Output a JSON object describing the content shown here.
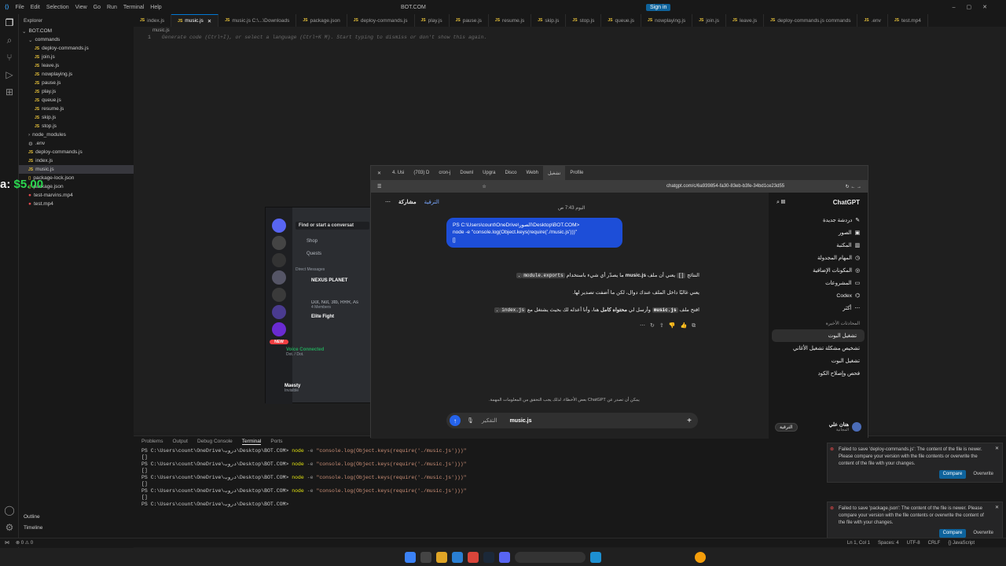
{
  "vscode": {
    "title": "BOT.COM",
    "menu": [
      "File",
      "Edit",
      "Selection",
      "View",
      "Go",
      "Run",
      "Terminal",
      "Help"
    ],
    "sign_in": "Sign in",
    "explorer_title": "Explorer",
    "tree": [
      {
        "label": "BOT.COM",
        "indent": 0,
        "type": "folder-open"
      },
      {
        "label": "commands",
        "indent": 1,
        "type": "folder-open"
      },
      {
        "label": "deploy-commands.js",
        "indent": 2,
        "type": "js"
      },
      {
        "label": "join.js",
        "indent": 2,
        "type": "js"
      },
      {
        "label": "leave.js",
        "indent": 2,
        "type": "js"
      },
      {
        "label": "nowplaying.js",
        "indent": 2,
        "type": "js"
      },
      {
        "label": "pause.js",
        "indent": 2,
        "type": "js"
      },
      {
        "label": "play.js",
        "indent": 2,
        "type": "js"
      },
      {
        "label": "queue.js",
        "indent": 2,
        "type": "js"
      },
      {
        "label": "resume.js",
        "indent": 2,
        "type": "js"
      },
      {
        "label": "skip.js",
        "indent": 2,
        "type": "js"
      },
      {
        "label": "stop.js",
        "indent": 2,
        "type": "js"
      },
      {
        "label": "node_modules",
        "indent": 1,
        "type": "folder"
      },
      {
        "label": ".env",
        "indent": 1,
        "type": "env"
      },
      {
        "label": "deploy-commands.js",
        "indent": 1,
        "type": "js"
      },
      {
        "label": "index.js",
        "indent": 1,
        "type": "js"
      },
      {
        "label": "music.js",
        "indent": 1,
        "type": "js",
        "selected": true
      },
      {
        "label": "package-lock.json",
        "indent": 1,
        "type": "json"
      },
      {
        "label": "package.json",
        "indent": 1,
        "type": "json"
      },
      {
        "label": "test-marvins.mp4",
        "indent": 1,
        "type": "media"
      },
      {
        "label": "test.mp4",
        "indent": 1,
        "type": "media"
      }
    ],
    "outline_label": "Outline",
    "timeline_label": "Timeline",
    "tabs": [
      "index.js",
      "music.js",
      "music.js C:\\...\\Downloads",
      "package.json",
      "deploy-commands.js",
      "play.js",
      "pause.js",
      "resume.js",
      "skip.js",
      "stop.js",
      "queue.js",
      "nowplaying.js",
      "join.js",
      "leave.js",
      "deploy-commands.js commands",
      ".env",
      "test.mp4"
    ],
    "breadcrumb": "music.js",
    "line_number": "1",
    "editor_hint": "Generate code (Ctrl+I), or select a language (Ctrl+K M). Start typing to dismiss or don't show this again.",
    "panel_tabs": [
      "Problems",
      "Output",
      "Debug Console",
      "Terminal",
      "Ports"
    ],
    "terminal": [
      {
        "prompt": "PS C:\\Users\\count\\OneDrive\\دروب\\Desktop\\BOT.COM>",
        "cmd": "node",
        "flag": "-e",
        "arg": "\"console.log(Object.keys(require('./music.js')))\""
      },
      {
        "output": "[]"
      },
      {
        "prompt": "PS C:\\Users\\count\\OneDrive\\دروب\\Desktop\\BOT.COM>",
        "cmd": "node",
        "flag": "-e",
        "arg": "\"console.log(Object.keys(require('./music.js')))\""
      },
      {
        "output": "[]"
      },
      {
        "prompt": "PS C:\\Users\\count\\OneDrive\\دروب\\Desktop\\BOT.COM>",
        "cmd": "node",
        "flag": "-e",
        "arg": "\"console.log(Object.keys(require('./music.js')))\""
      },
      {
        "output": "[]"
      },
      {
        "prompt": "PS C:\\Users\\count\\OneDrive\\دروب\\Desktop\\BOT.COM>",
        "cmd": "node",
        "flag": "-e",
        "arg": "\"console.log(Object.keys(require('./music.js')))\""
      },
      {
        "output": "[]"
      },
      {
        "prompt": "PS C:\\Users\\count\\OneDrive\\دروب\\Desktop\\BOT.COM>",
        "cmd": "",
        "flag": "",
        "arg": ""
      }
    ],
    "status_left": "⊗ 0 ⚠ 0",
    "status_right": [
      "Ln 1, Col 1",
      "Spaces: 4",
      "UTF-8",
      "CRLF",
      "{} JavaScript"
    ],
    "notifications": [
      {
        "text": "Failed to save 'deploy-commands.js': The content of the file is newer. Please compare your version with the file contents or overwrite the content of the file with your changes.",
        "compare": "Compare",
        "overwrite": "Overwrite"
      },
      {
        "text": "Failed to save 'package.json': The content of the file is newer. Please compare your version with the file contents or overwrite the content of the file with your changes.",
        "compare": "Compare",
        "overwrite": "Overwrite"
      }
    ]
  },
  "overlay_price": {
    "label": "a:",
    "value": "$5.00"
  },
  "discord": {
    "search": "Find or start a conversat",
    "shop": "Shop",
    "quests": "Quests",
    "dm_header": "Direct Messages",
    "dms": [
      "NEXUS PLANET",
      "Dot, Not, 3tb, RRR, As",
      "Elite Fight"
    ],
    "dm_sub": "4 Members",
    "new_badge": "NEW",
    "voice_status": "Voice Connected",
    "voice_sub": "Dot. / Dot.",
    "user": "Maesty",
    "user_status": "Invisible"
  },
  "chrome": {
    "tabs": [
      "4. Usi",
      "(703) D",
      "cron-j",
      "Downl",
      "Upgra",
      "Disco",
      "Webh",
      "تشغيل",
      "Profile"
    ],
    "url": "chatgpt.com/c/6a939854-fa30-83eb-b3fe-34bd1ce23d55"
  },
  "chatgpt": {
    "brand": "ChatGPT",
    "sidebar_items": [
      "دردشة جديدة",
      "الصور",
      "المكتبة",
      "المهام المجدولة",
      "المكونات الإضافية",
      "المشروعات",
      "Codex",
      "أكثر"
    ],
    "recent_header": "المحادثات الأخيرة",
    "recent": [
      "تشغيل البوت",
      "تشخيص مشكلة تشغيل الأغاني",
      "تشغيل البوت",
      "فحص وإصلاح الكود"
    ],
    "user_name": "هتان علي",
    "user_plan": "المجانية",
    "upgrade": "الترقية",
    "header_share": "مشاركة",
    "header_upgrade": "الترقية",
    "time": "اليوم 7:43 ص",
    "user_message": "PS C:\\Users\\count\\OneDrive\\الصور\\Desktop\\BOT.COM>\nnode -e \"console.log(Object.keys(require('./music.js')))\"\n[]",
    "answer_lines": [
      [
        "النتائج ",
        "[]",
        " يعني أن ملف ",
        "music.js",
        " ما يصدّر أي شيء باستخدام ",
        "module.exports",
        "."
      ],
      [
        "يعني غالبًا داخل الملف عندك دوال، لكن ما أضفت تصدير لها."
      ],
      [
        "افتح ملف ",
        "music.js",
        " وأرسل لي ",
        "محتواه كامل",
        " هنا، وأنا أعدله لك بحيث يشتغل مع ",
        "index.js",
        "."
      ]
    ],
    "disclaimer": "يمكن أن تصدر عن ChatGPT بعض الأخطاء. لذلك يجب التحقق من المعلومات المهمة.",
    "composer_text": "music.js",
    "think_label": "التفكير"
  },
  "tray": {
    "weather": "Sunny",
    "time": "--"
  }
}
